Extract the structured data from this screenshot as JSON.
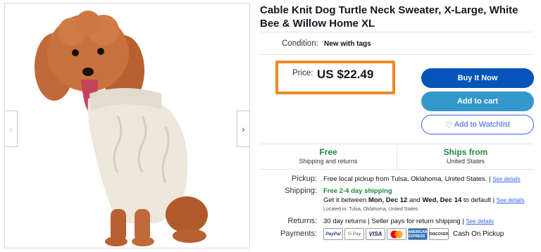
{
  "product": {
    "title": "Cable Knit Dog Turtle Neck Sweater, X-Large, White Bee & Willow Home XL"
  },
  "gallery": {
    "prev_icon": "‹",
    "next_icon": "›"
  },
  "condition": {
    "label": "Condition:",
    "value": "New with tags"
  },
  "price": {
    "label": "Price:",
    "value": "US $22.49",
    "highlight_color": "#f08a24"
  },
  "actions": {
    "buy_now": "Buy It Now",
    "add_to_cart": "Add to cart",
    "watchlist_icon": "♡",
    "watchlist": "Add to Watchlist"
  },
  "shipping_summary": {
    "left_head": "Free",
    "left_sub": "Shipping and returns",
    "right_head": "Ships from",
    "right_sub": "United States"
  },
  "pickup": {
    "label": "Pickup:",
    "text": "Free local pickup from Tulsa, Oklahoma, United States.",
    "separator": "|",
    "link": "See details"
  },
  "shipping": {
    "label": "Shipping:",
    "headline": "Free 2-4 day shipping",
    "get_it_prefix": "Get it between",
    "date_start": "Mon, Dec 12",
    "and_word": "and",
    "date_end": "Wed, Dec 14",
    "suffix": "to default",
    "separator": "|",
    "link": "See details",
    "located": "Located in: Tulsa, Oklahoma, United States"
  },
  "returns": {
    "label": "Returns:",
    "text": "30 day returns | Seller pays for return shipping",
    "separator": "|",
    "link": "See details"
  },
  "payments": {
    "label": "Payments:",
    "methods": [
      "PayPal",
      "G Pay",
      "VISA",
      "mastercard-icon",
      "AMERICAN EXPRESS",
      "DISCOVER"
    ],
    "cash": "Cash On Pickup"
  },
  "colors": {
    "buy_now": "#0654ba",
    "add_to_cart": "#3498ca",
    "link": "#3665f3",
    "green": "#1e8a3a"
  }
}
